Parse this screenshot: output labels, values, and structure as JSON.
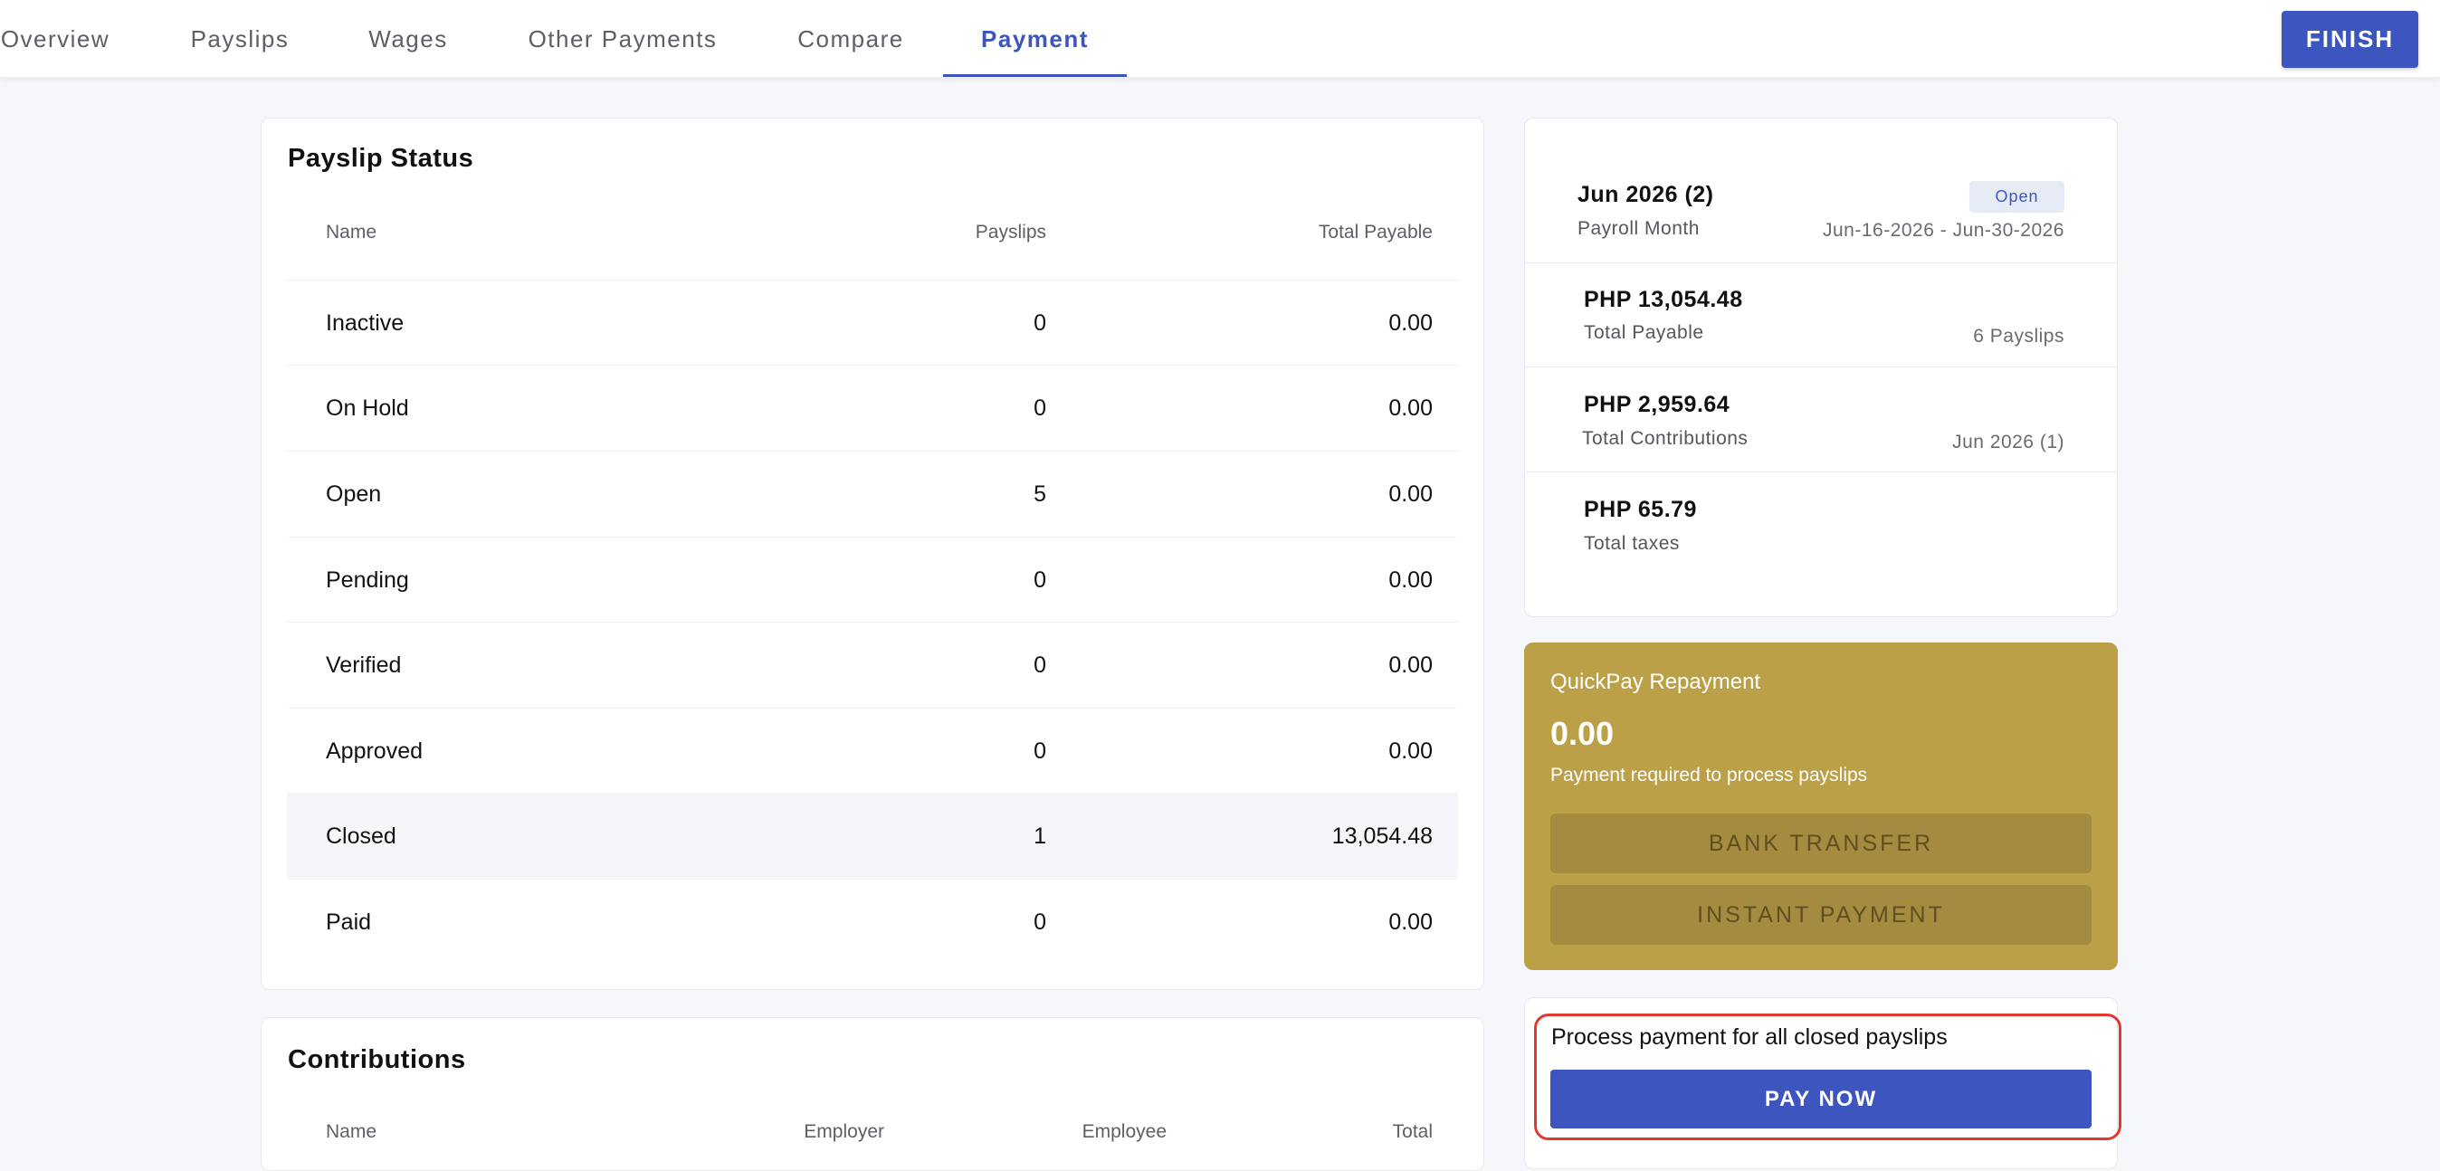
{
  "nav": {
    "tabs": [
      {
        "label": "Overview"
      },
      {
        "label": "Payslips"
      },
      {
        "label": "Wages"
      },
      {
        "label": "Other Payments"
      },
      {
        "label": "Compare"
      },
      {
        "label": "Payment",
        "active": true
      }
    ],
    "finish_label": "FINISH"
  },
  "payslip_status": {
    "title": "Payslip Status",
    "columns": [
      "Name",
      "Payslips",
      "Total Payable"
    ],
    "rows": [
      {
        "name": "Inactive",
        "payslips": "0",
        "total": "0.00"
      },
      {
        "name": "On Hold",
        "payslips": "0",
        "total": "0.00"
      },
      {
        "name": "Open",
        "payslips": "5",
        "total": "0.00"
      },
      {
        "name": "Pending",
        "payslips": "0",
        "total": "0.00"
      },
      {
        "name": "Verified",
        "payslips": "0",
        "total": "0.00"
      },
      {
        "name": "Approved",
        "payslips": "0",
        "total": "0.00"
      },
      {
        "name": "Closed",
        "payslips": "1",
        "total": "13,054.48",
        "highlighted": true
      },
      {
        "name": "Paid",
        "payslips": "0",
        "total": "0.00"
      }
    ]
  },
  "contributions": {
    "title": "Contributions",
    "columns": [
      "Name",
      "Employer",
      "Employee",
      "Total"
    ]
  },
  "summary": {
    "month": "Jun 2026 (2)",
    "month_label": "Payroll Month",
    "status_badge": "Open",
    "date_range": "Jun-16-2026 - Jun-30-2026",
    "total_payable": "PHP 13,054.48",
    "total_payable_label": "Total Payable",
    "payslip_count": "6 Payslips",
    "total_contributions": "PHP 2,959.64",
    "total_contributions_label": "Total Contributions",
    "contributions_period": "Jun 2026 (1)",
    "total_taxes": "PHP 65.79",
    "total_taxes_label": "Total taxes"
  },
  "quickpay": {
    "title": "QuickPay Repayment",
    "amount": "0.00",
    "note": "Payment required to process payslips",
    "bank_transfer_label": "BANK TRANSFER",
    "instant_payment_label": "INSTANT PAYMENT",
    "background_color": "#bba047"
  },
  "process": {
    "text": "Process payment for all closed payslips",
    "pay_now_label": "PAY NOW"
  },
  "colors": {
    "accent": "#3d55be",
    "highlight_box": "#e03a2f"
  }
}
